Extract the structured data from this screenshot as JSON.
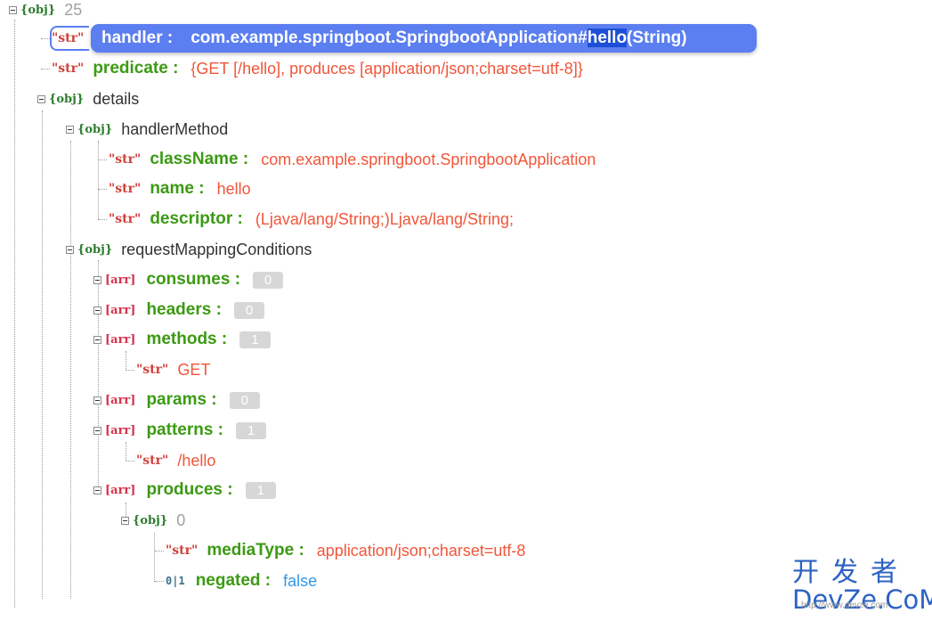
{
  "root": {
    "type_tag": "{obj}",
    "count": "25"
  },
  "handler": {
    "type_tag": "\"str\"",
    "key": "handler :",
    "value_before": "com.example.springboot.SpringbootApplication#",
    "value_selected": "hello",
    "value_after": "(String)"
  },
  "predicate": {
    "type_tag": "\"str\"",
    "key": "predicate :",
    "value": "{GET [/hello], produces [application/json;charset=utf-8]}"
  },
  "details": {
    "type_tag": "{obj}",
    "label": "details"
  },
  "handlerMethod": {
    "type_tag": "{obj}",
    "label": "handlerMethod"
  },
  "className": {
    "type_tag": "\"str\"",
    "key": "className :",
    "value": "com.example.springboot.SpringbootApplication"
  },
  "name": {
    "type_tag": "\"str\"",
    "key": "name :",
    "value": "hello"
  },
  "descriptor": {
    "type_tag": "\"str\"",
    "key": "descriptor :",
    "value": "(Ljava/lang/String;)Ljava/lang/String;"
  },
  "requestMappingConditions": {
    "type_tag": "{obj}",
    "label": "requestMappingConditions"
  },
  "consumes": {
    "type_tag": "[arr]",
    "key": "consumes :",
    "count": "0"
  },
  "headers": {
    "type_tag": "[arr]",
    "key": "headers :",
    "count": "0"
  },
  "methods": {
    "type_tag": "[arr]",
    "key": "methods :",
    "count": "1"
  },
  "methods_item": {
    "type_tag": "\"str\"",
    "value": "GET"
  },
  "params": {
    "type_tag": "[arr]",
    "key": "params :",
    "count": "0"
  },
  "patterns": {
    "type_tag": "[arr]",
    "key": "patterns :",
    "count": "1"
  },
  "patterns_item": {
    "type_tag": "\"str\"",
    "value": "/hello"
  },
  "produces": {
    "type_tag": "[arr]",
    "key": "produces :",
    "count": "1"
  },
  "produces_obj": {
    "type_tag": "{obj}",
    "count": "0"
  },
  "mediaType": {
    "type_tag": "\"str\"",
    "key": "mediaType :",
    "value": "application/json;charset=utf-8"
  },
  "negated": {
    "type_tag": "0|1",
    "key": "negated :",
    "value": "false"
  },
  "watermark": {
    "chinese": "开发者",
    "english": "DevZe.CoM",
    "small": "http://www.devze.com"
  },
  "colors": {
    "key_green": "#3c9a14",
    "string_value": "#f0563a",
    "bool_value": "#3399e6",
    "highlight": "#5b7ef0",
    "watermark_blue": "#2c62c2"
  },
  "icons": {
    "expand_collapse": "minus-box-icon"
  }
}
